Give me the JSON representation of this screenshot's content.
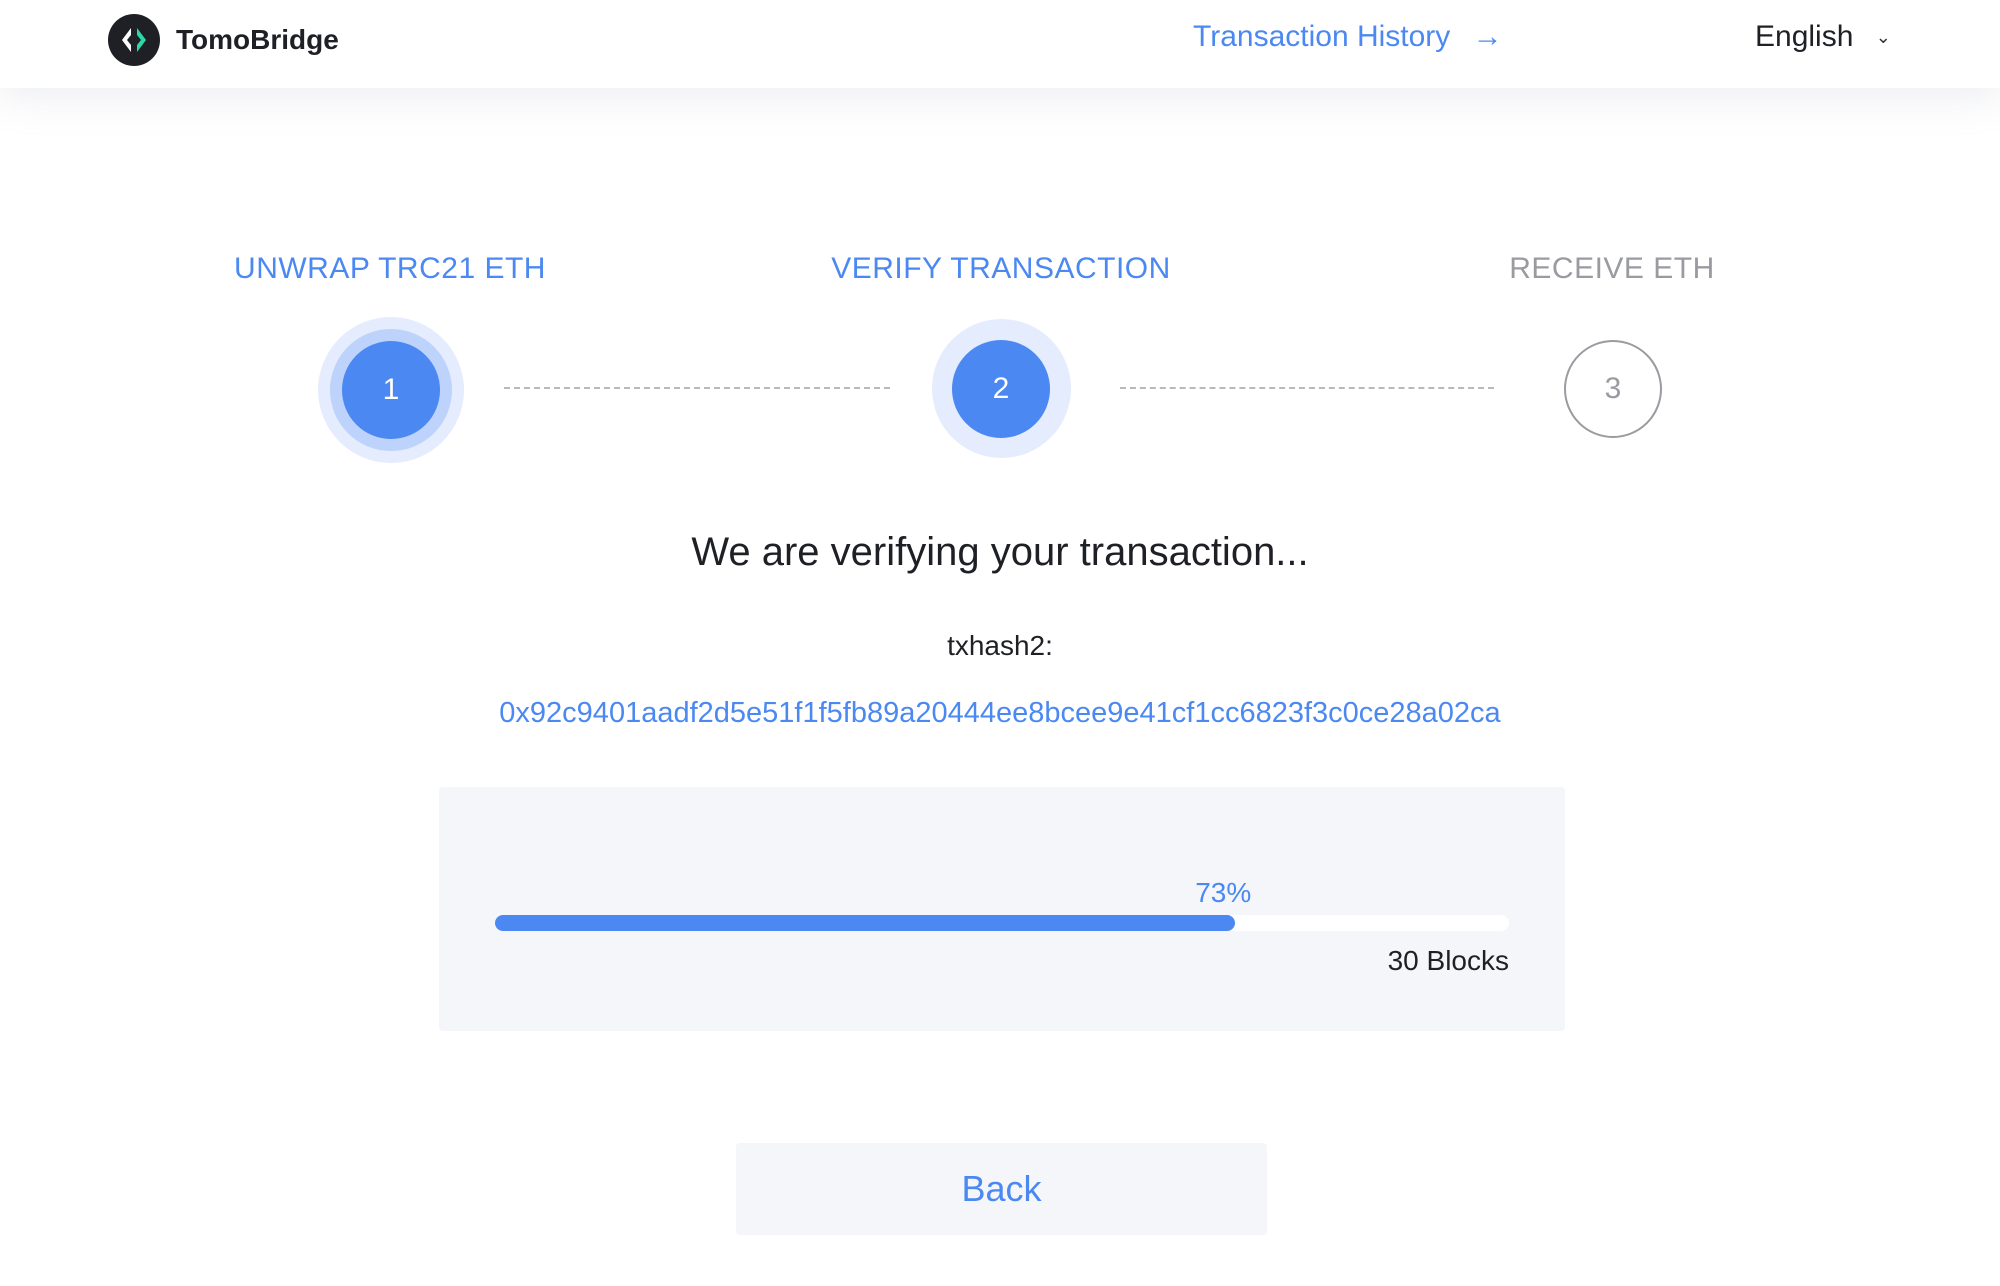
{
  "header": {
    "brand": "TomoBridge",
    "history_link": "Transaction History",
    "history_arrow": "→",
    "language": "English",
    "language_chevron": "⌄"
  },
  "steps": [
    {
      "label": "UNWRAP TRC21 ETH",
      "number": "1",
      "state": "done"
    },
    {
      "label": "VERIFY TRANSACTION",
      "number": "2",
      "state": "current"
    },
    {
      "label": "RECEIVE ETH",
      "number": "3",
      "state": "pending"
    }
  ],
  "verify": {
    "title": "We are verifying your transaction...",
    "hash_label": "txhash2:",
    "hash_value": "0x92c9401aadf2d5e51f1f5fb89a20444ee8bcee9e41cf1cc6823f3c0ce28a02ca"
  },
  "progress": {
    "percent_label": "73%",
    "percent": 73,
    "blocks_label": "30 Blocks"
  },
  "actions": {
    "back_label": "Back"
  },
  "colors": {
    "accent": "#4b88f2",
    "inactive": "#9a9ba0",
    "card_bg": "#f4f6fa"
  }
}
